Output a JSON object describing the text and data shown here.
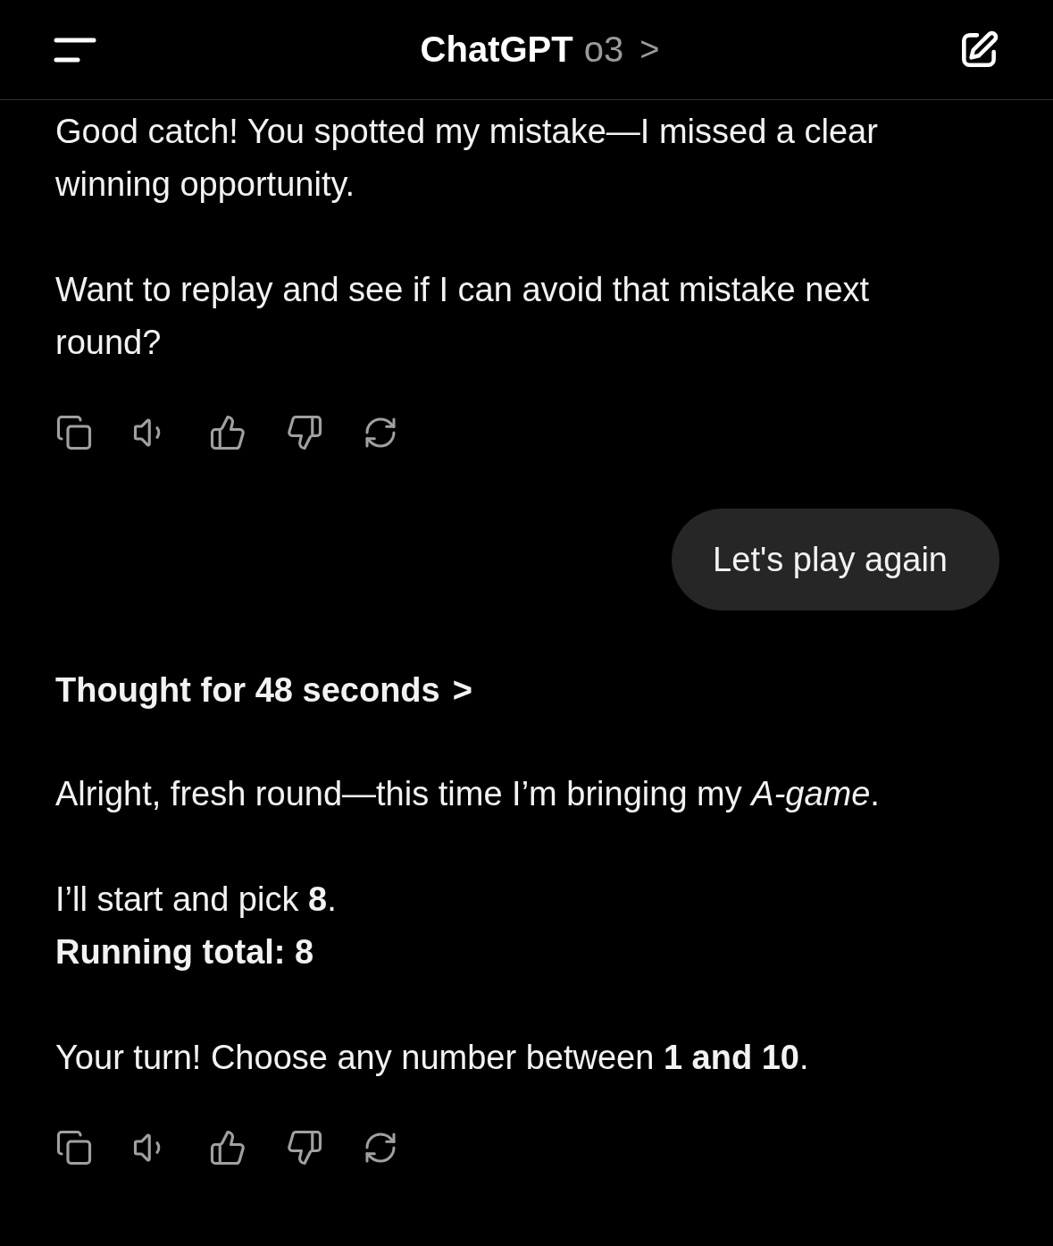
{
  "header": {
    "title": "ChatGPT",
    "model": "o3",
    "chevron": ">"
  },
  "messages": [
    {
      "kind": "assistant",
      "paragraphs": [
        [
          {
            "text": "Good catch! You spotted my mistake—I missed a clear winning opportunity.",
            "bold": false
          }
        ],
        [
          {
            "text": "Want to replay and see if I can avoid that mistake next round?",
            "bold": false
          }
        ]
      ]
    },
    {
      "kind": "user",
      "text": "Let's play again"
    },
    {
      "kind": "thought",
      "text": "Thought for 48 seconds",
      "chevron": ">"
    },
    {
      "kind": "assistant",
      "paragraphs": [
        [
          {
            "text": "Alright, fresh round—this time I’m bringing my *A-game*.",
            "bold": false
          }
        ],
        [
          {
            "text": "I’ll start and pick **8**.",
            "bold": false
          },
          {
            "text": "Running total: 8",
            "bold": true
          }
        ],
        [
          {
            "text": "Your turn! Choose any number between **1 and 10**.",
            "bold": false
          }
        ]
      ]
    }
  ]
}
